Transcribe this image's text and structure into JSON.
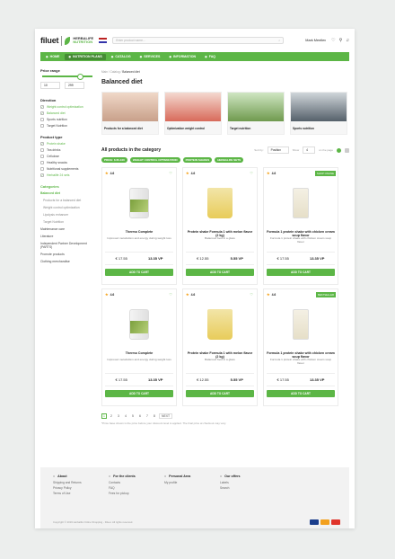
{
  "header": {
    "logo_filuet": "filuet",
    "logo_herbalife": "HERBALIFE",
    "logo_nutrition": "NUTRITION",
    "search_placeholder": "Enter product name...",
    "user_name": "Mark Mentlev"
  },
  "nav": [
    {
      "label": "HOME",
      "icon": "home-icon"
    },
    {
      "label": "NUTRITION PLANS",
      "icon": "leaf-icon",
      "active": true
    },
    {
      "label": "CATALOG",
      "icon": "grid-icon"
    },
    {
      "label": "SERVICES",
      "icon": "services-icon"
    },
    {
      "label": "INFORMATION",
      "icon": "info-icon"
    },
    {
      "label": "FAQ",
      "icon": "help-icon"
    }
  ],
  "filters": {
    "price_title": "Price range",
    "price_min": "10",
    "price_max": "299",
    "direction_title": "Direction",
    "direction": [
      {
        "label": "Weight control optimization",
        "checked": true
      },
      {
        "label": "Balanced diet",
        "checked": true
      },
      {
        "label": "Sports nutrition",
        "checked": false
      },
      {
        "label": "Target Nutrition",
        "checked": false
      }
    ],
    "type_title": "Product type",
    "types": [
      {
        "label": "Protein shake",
        "checked": true
      },
      {
        "label": "Tea drinks",
        "checked": false
      },
      {
        "label": "Cellulose",
        "checked": false
      },
      {
        "label": "Healthy snacks",
        "checked": false
      },
      {
        "label": "Nutritional supplements",
        "checked": false
      },
      {
        "label": "Herbalife 24 sets",
        "checked": true
      }
    ],
    "categories_title": "Categories",
    "categories": [
      {
        "label": "Balanced diet",
        "active": true,
        "sub": false
      },
      {
        "label": "Products for a balanced diet",
        "sub": true
      },
      {
        "label": "Weight control optimization",
        "sub": true
      },
      {
        "label": "Lipolysis enhancer",
        "sub": true
      },
      {
        "label": "Target Nutrition",
        "sub": true
      },
      {
        "label": "Maintenance care",
        "sub": false
      },
      {
        "label": "Literature",
        "sub": false
      },
      {
        "label": "Independent Partner Development (PARTS)",
        "sub": false
      },
      {
        "label": "Promote products",
        "sub": false
      },
      {
        "label": "Clothing merchandise",
        "sub": false
      }
    ]
  },
  "breadcrumb": {
    "home": "Main",
    "sep": "/",
    "catalog": "Catalog",
    "current": "Balanced diet"
  },
  "page_title": "Balanced diet",
  "featured": [
    {
      "label": "Products for a balanced diet"
    },
    {
      "label": "Optimization weight control"
    },
    {
      "label": "Target nutrition"
    },
    {
      "label": "Sports nutrition"
    }
  ],
  "toolbar": {
    "title": "All products in the category",
    "sort_label": "Sort by:",
    "sort_value": "Position",
    "show_label": "Show",
    "show_value": "4",
    "per_page": "on the page"
  },
  "chips": [
    "PRICE: $ 80-100",
    "WEIGHT CONTROL OPTIMIZATION",
    "PROTEIN SHAKES",
    "HERBALIFE SETS"
  ],
  "products": [
    {
      "rating": "4.6",
      "name": "Thermo Complete",
      "desc": "Improved metabolism and energy during weight loss",
      "price": "€ 17.55",
      "pv": "13.35 VP",
      "button": "ADD TO CART",
      "badge": "",
      "image": "jar"
    },
    {
      "rating": "4.6",
      "name": "Protein shake Formula 1 with melon flavor (2 kg)",
      "desc": "Balanced food in a glass",
      "price": "€ 12.55",
      "pv": "5.55 VP",
      "button": "ADD TO CART",
      "badge": "",
      "image": "bag"
    },
    {
      "rating": "4.6",
      "name": "Formula 1 protein shake with chicken cream soup flavor",
      "desc": "Formula 1 protein shake with chicken cream soup flavor",
      "price": "€ 17.55",
      "pv": "13.35 VP",
      "button": "ADD TO CART",
      "badge": "SHOP ONLINE",
      "image": "can"
    },
    {
      "rating": "4.6",
      "name": "Thermo Complete",
      "desc": "Improved metabolism and energy during weight loss",
      "price": "€ 17.55",
      "pv": "13.35 VP",
      "button": "ADD TO CART",
      "badge": "",
      "image": "jar"
    },
    {
      "rating": "4.6",
      "name": "Protein shake Formula 1 with melon flavor (2 kg)",
      "desc": "Balanced food in a glass",
      "price": "€ 12.55",
      "pv": "5.55 VP",
      "button": "ADD TO CART",
      "badge": "",
      "image": "bag"
    },
    {
      "rating": "4.6",
      "name": "Formula 1 protein shake with chicken cream soup flavor",
      "desc": "Formula 1 protein shake with chicken cream soup flavor",
      "price": "€ 17.55",
      "pv": "13.35 VP",
      "button": "ADD TO CART",
      "badge": "BESTSELLER",
      "image": "can"
    }
  ],
  "pagination": {
    "pages": [
      "1",
      "2",
      "3",
      "4",
      "5",
      "6",
      "7",
      "8"
    ],
    "current": "1",
    "next": "NEXT"
  },
  "note": "*Price base shown is the price before your discount level is applied. The final price at checkout may vary.",
  "footer": {
    "columns": [
      {
        "title": "About",
        "links": [
          "Shipping and Returns",
          "Privacy Policy",
          "Terms of Use"
        ]
      },
      {
        "title": "For the clients",
        "links": [
          "Contacts",
          "FAQ",
          "Fees for pickup"
        ]
      },
      {
        "title": "Personal Area",
        "links": [
          "My profile"
        ]
      },
      {
        "title": "Our offers",
        "links": [
          "Labels",
          "Search"
        ]
      }
    ],
    "copyright": "Copyright © 2019 Herbalife Online Shopping - Filuet. All rights reserved.",
    "payments": [
      "#1a3e8c",
      "#f2a01e",
      "#e0342b"
    ]
  },
  "colors": {
    "accent": "#5cb646"
  }
}
